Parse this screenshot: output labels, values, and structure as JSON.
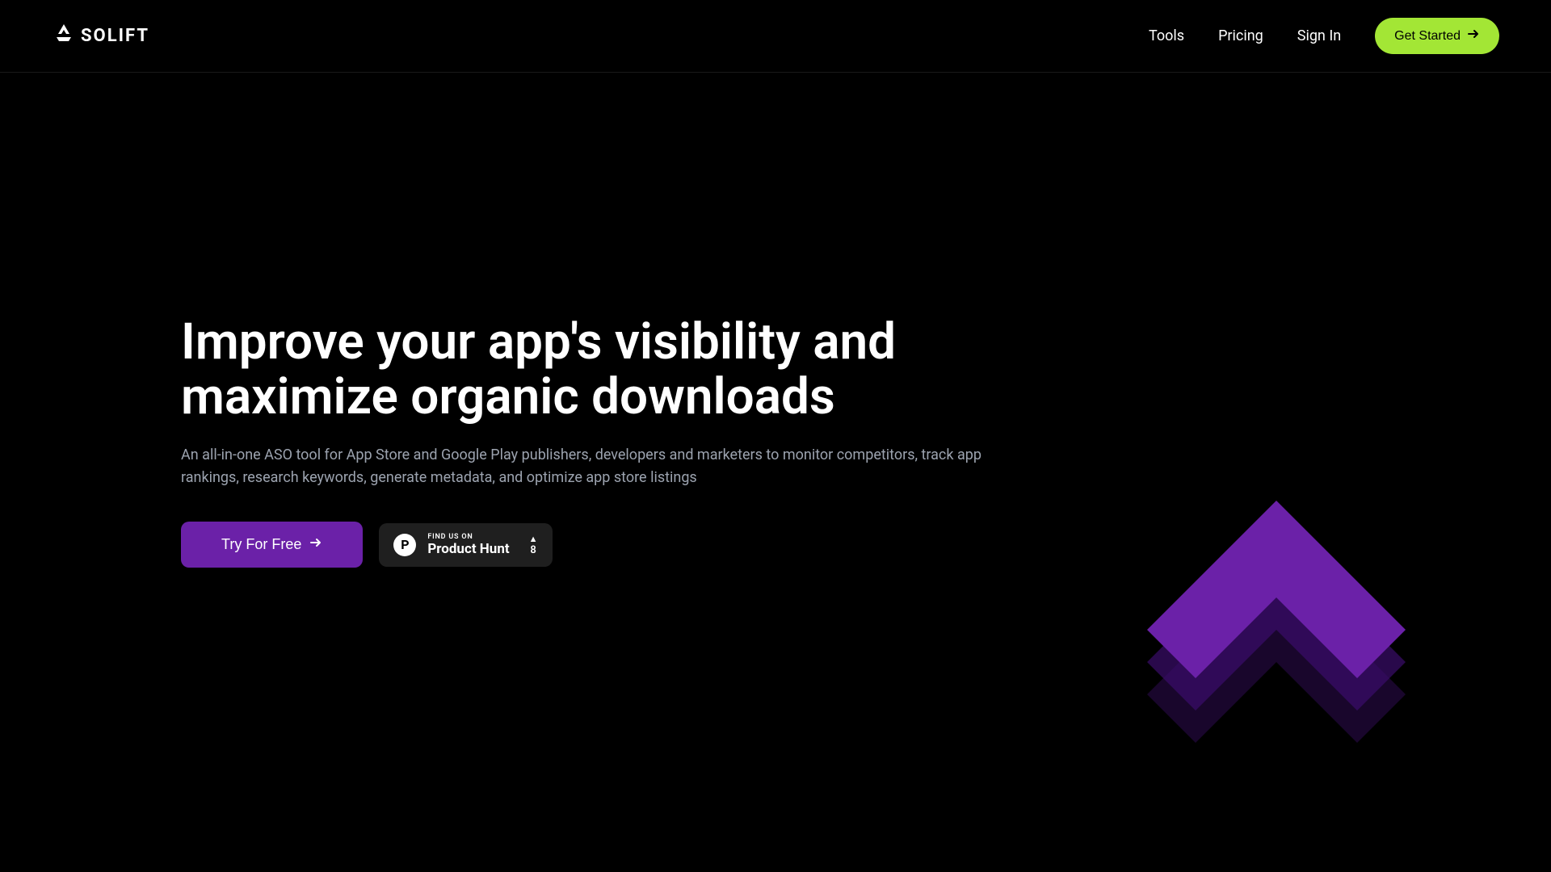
{
  "header": {
    "logo_text": "SOLIFT",
    "nav": {
      "tools": "Tools",
      "pricing": "Pricing",
      "signin": "Sign In",
      "get_started": "Get Started"
    }
  },
  "hero": {
    "title": "Improve your app's visibility and maximize organic downloads",
    "subtitle": "An all-in-one ASO tool for App Store and Google Play publishers, developers and marketers to monitor competitors, track app rankings, research keywords, generate metadata, and optimize app store listings",
    "try_free": "Try For Free",
    "product_hunt": {
      "find_us": "FIND US ON",
      "name": "Product Hunt",
      "count": "8"
    }
  }
}
